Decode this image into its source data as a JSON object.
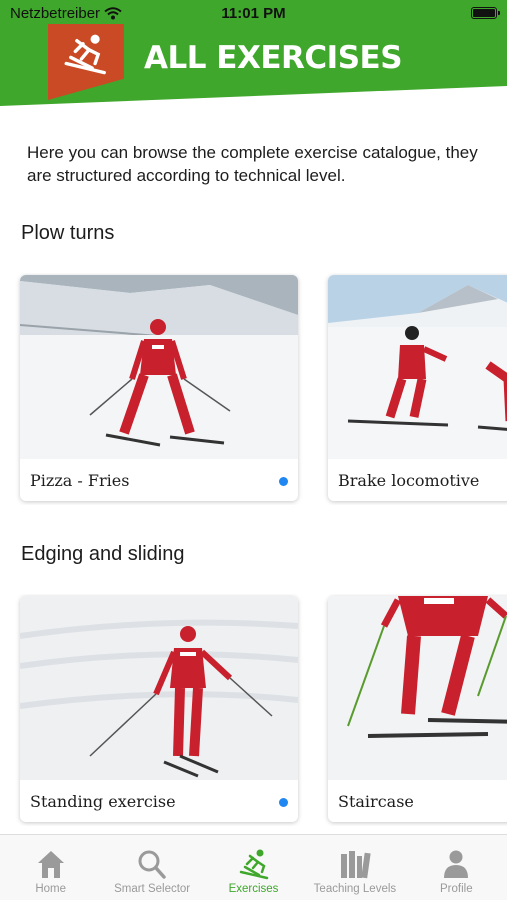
{
  "status_bar": {
    "carrier": "Netzbetreiber",
    "time": "11:01 PM"
  },
  "header": {
    "title": "ALL EXERCISES"
  },
  "intro": "Here you can browse the complete exercise catalogue, they are structured according to technical level.",
  "sections": [
    {
      "title": "Plow turns",
      "cards": [
        {
          "label": "Pizza - Fries",
          "new": true
        },
        {
          "label": "Brake locomotive",
          "new": false
        }
      ]
    },
    {
      "title": "Edging and sliding",
      "cards": [
        {
          "label": "Standing exercise",
          "new": true
        },
        {
          "label": "Staircase",
          "new": false
        }
      ]
    }
  ],
  "tabs": [
    {
      "label": "Home",
      "icon": "home-icon",
      "active": false
    },
    {
      "label": "Smart Selector",
      "icon": "search-icon",
      "active": false
    },
    {
      "label": "Exercises",
      "icon": "skier-icon",
      "active": true
    },
    {
      "label": "Teaching Levels",
      "icon": "books-icon",
      "active": false
    },
    {
      "label": "Profile",
      "icon": "profile-icon",
      "active": false
    }
  ],
  "colors": {
    "brand_green": "#3fa72b",
    "brand_orange": "#c94a25",
    "active_tab": "#3fa72b",
    "new_dot": "#1f86f2",
    "ski_suit": "#c8202c"
  }
}
